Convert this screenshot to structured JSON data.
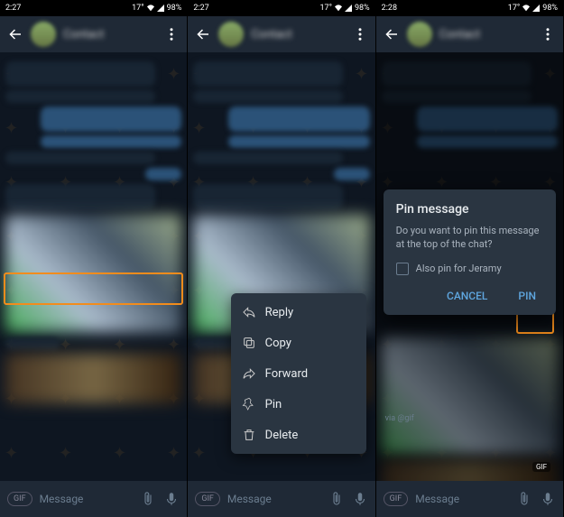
{
  "status": {
    "t1": "2:27",
    "t2": "2:27",
    "t3": "2:28",
    "battery": "98%",
    "temp": "17°"
  },
  "header": {
    "name": "Contact"
  },
  "input": {
    "placeholder": "Message",
    "gif": "GIF"
  },
  "ctx": {
    "reply": "Reply",
    "copy": "Copy",
    "forward": "Forward",
    "pin": "Pin",
    "delete": "Delete"
  },
  "dialog": {
    "title": "Pin message",
    "body": "Do you want to pin this message at the top of the chat?",
    "also": "Also pin for Jeramy",
    "cancel": "CANCEL",
    "ok": "PIN"
  },
  "meta": {
    "via": "via @gif",
    "gif": "GIF"
  }
}
